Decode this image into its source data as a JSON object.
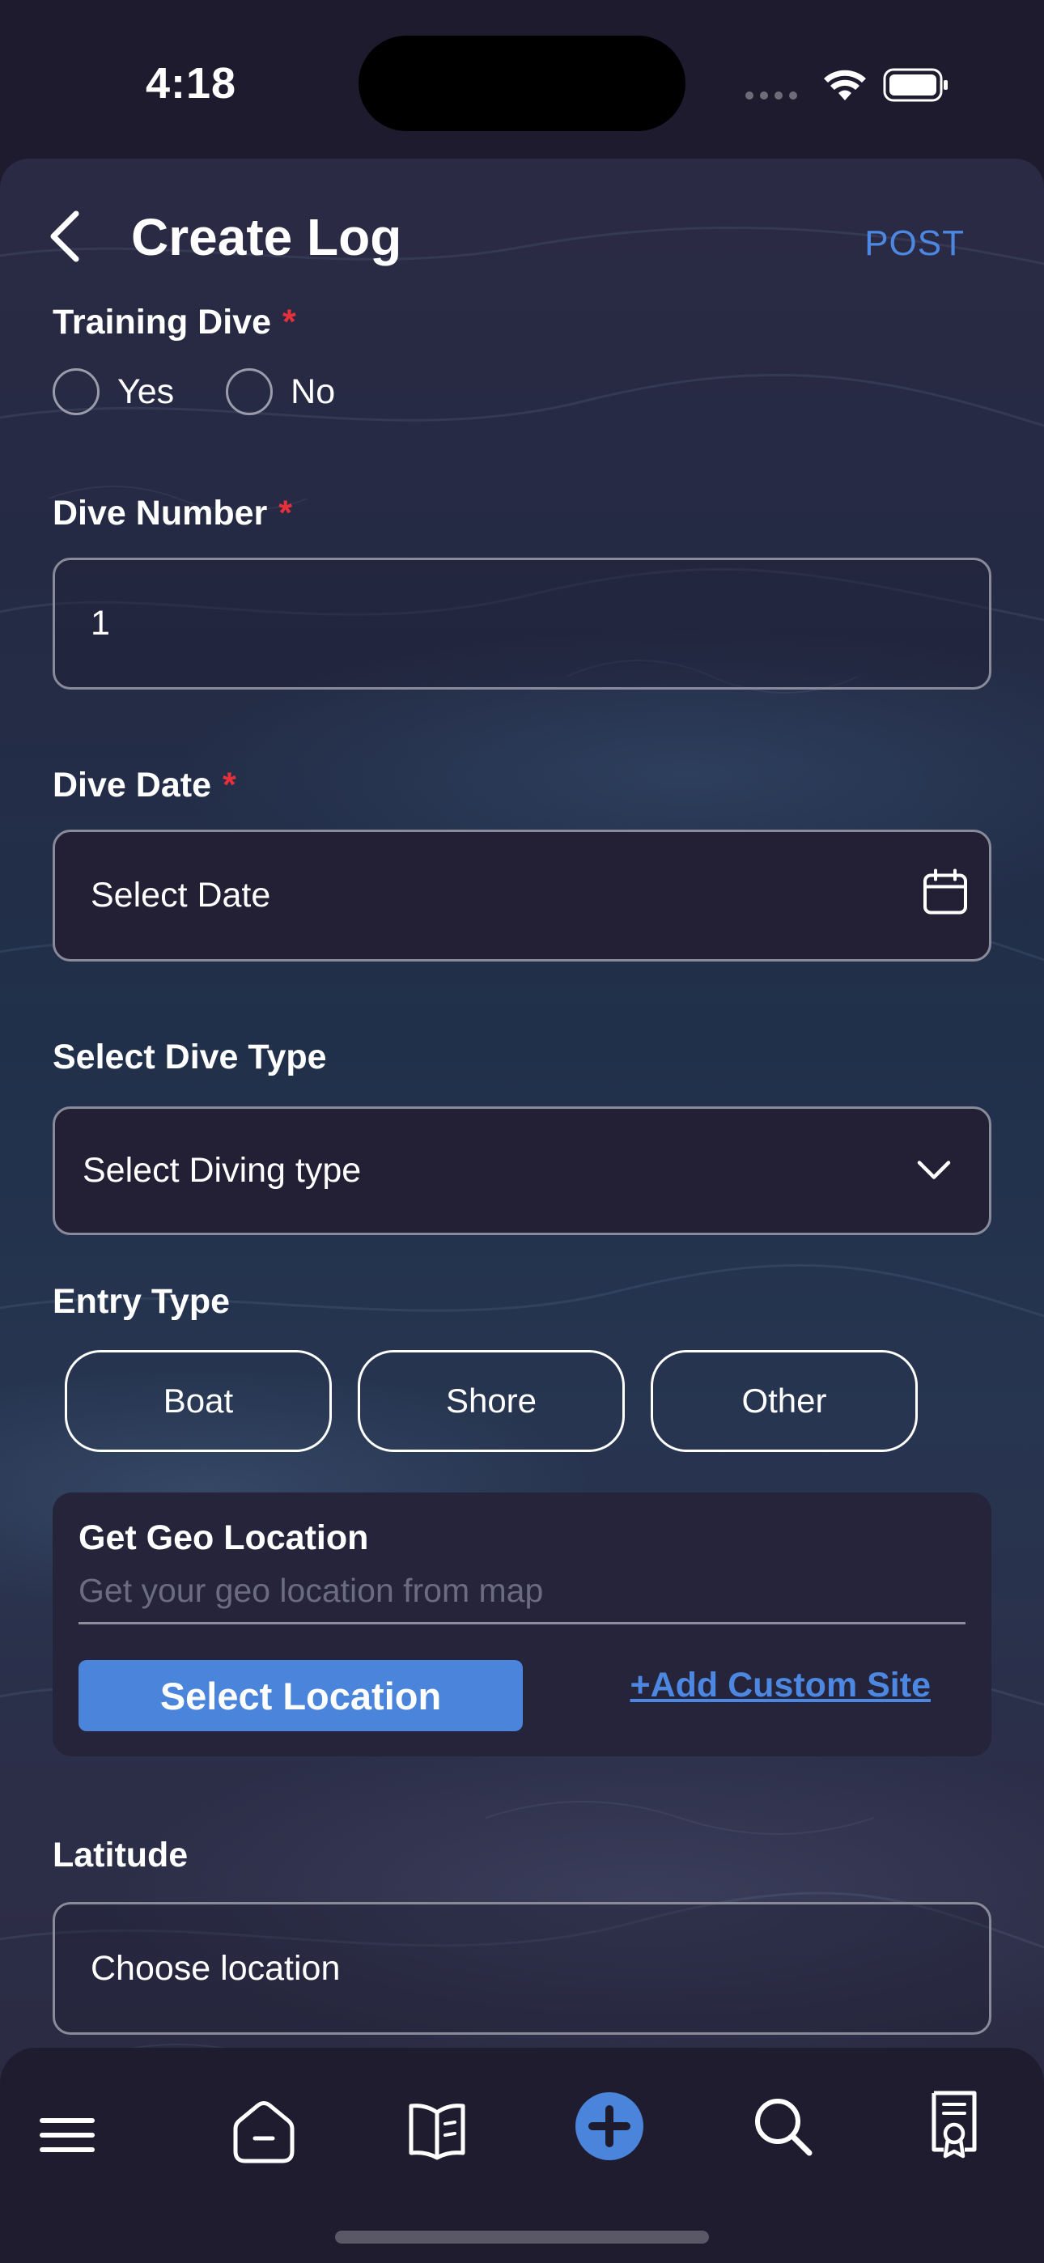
{
  "status_bar": {
    "time": "4:18"
  },
  "header": {
    "title": "Create Log",
    "post_label": "POST"
  },
  "form": {
    "training_dive": {
      "label": "Training Dive",
      "required_mark": "*",
      "options": [
        "Yes",
        "No"
      ],
      "selected": null
    },
    "dive_number": {
      "label": "Dive Number",
      "required_mark": "*",
      "value": "1"
    },
    "dive_date": {
      "label": "Dive Date",
      "required_mark": "*",
      "placeholder": "Select Date"
    },
    "dive_type": {
      "label": "Select Dive Type",
      "placeholder": "Select Diving type"
    },
    "entry_type": {
      "label": "Entry Type",
      "options": [
        "Boat",
        "Shore",
        "Other"
      ]
    },
    "geo": {
      "title": "Get Geo Location",
      "placeholder": "Get your geo location from map",
      "select_button": "Select Location",
      "custom_site_link": "+Add Custom Site"
    },
    "latitude": {
      "label": "Latitude",
      "placeholder": "Choose location"
    }
  },
  "tab_bar": {
    "items": [
      "menu-icon",
      "home-icon",
      "logbook-icon",
      "add-icon",
      "search-icon",
      "certificate-icon"
    ],
    "active": "add-icon"
  },
  "colors": {
    "accent": "#4c88e2",
    "required": "#e8303a",
    "background": "#1e1b2e"
  }
}
